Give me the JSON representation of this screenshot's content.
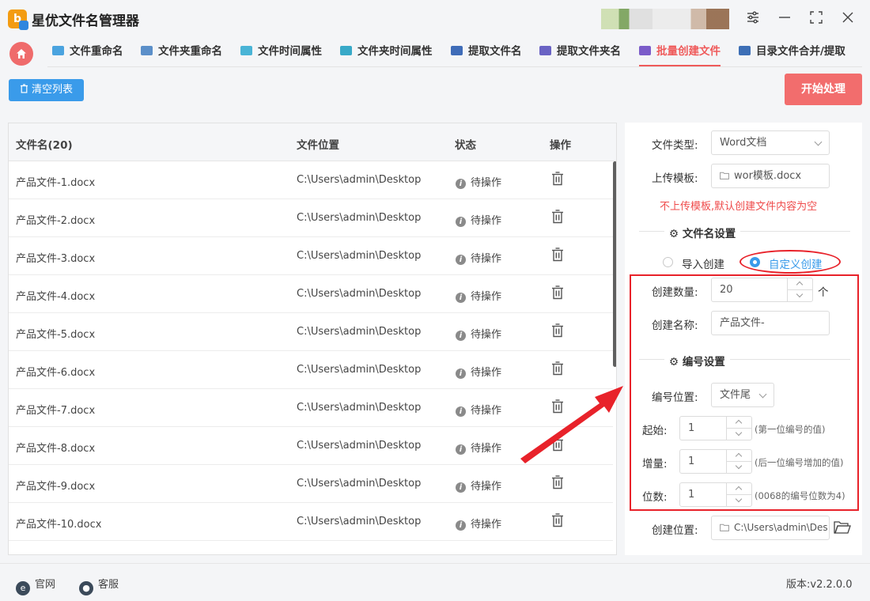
{
  "app": {
    "title": "星优文件名管理器"
  },
  "nav": {
    "tabs": [
      {
        "label": "文件重命名",
        "icon": "image-icon",
        "color": "#4aa3df"
      },
      {
        "label": "文件夹重命名",
        "icon": "folder-image-icon",
        "color": "#5b8fc9"
      },
      {
        "label": "文件时间属性",
        "icon": "layers-icon",
        "color": "#49b4d6"
      },
      {
        "label": "文件夹时间属性",
        "icon": "layers-icon",
        "color": "#38a9c8"
      },
      {
        "label": "提取文件名",
        "icon": "document-icon",
        "color": "#3f6cb8"
      },
      {
        "label": "提取文件夹名",
        "icon": "document-icon",
        "color": "#6a63c4"
      },
      {
        "label": "批量创建文件",
        "icon": "batch-create-icon",
        "color": "#7b5cc9",
        "active": true
      },
      {
        "label": "目录文件合并/提取",
        "icon": "book-icon",
        "color": "#3d6fb6"
      }
    ]
  },
  "toolbar": {
    "clear_label": "清空列表",
    "start_label": "开始处理"
  },
  "table": {
    "headers": [
      "文件名(20)",
      "文件位置",
      "状态",
      "操作"
    ],
    "rows": [
      {
        "name": "产品文件-1.docx",
        "path": "C:\\Users\\admin\\Desktop",
        "status": "待操作"
      },
      {
        "name": "产品文件-2.docx",
        "path": "C:\\Users\\admin\\Desktop",
        "status": "待操作"
      },
      {
        "name": "产品文件-3.docx",
        "path": "C:\\Users\\admin\\Desktop",
        "status": "待操作"
      },
      {
        "name": "产品文件-4.docx",
        "path": "C:\\Users\\admin\\Desktop",
        "status": "待操作"
      },
      {
        "name": "产品文件-5.docx",
        "path": "C:\\Users\\admin\\Desktop",
        "status": "待操作"
      },
      {
        "name": "产品文件-6.docx",
        "path": "C:\\Users\\admin\\Desktop",
        "status": "待操作"
      },
      {
        "name": "产品文件-7.docx",
        "path": "C:\\Users\\admin\\Desktop",
        "status": "待操作"
      },
      {
        "name": "产品文件-8.docx",
        "path": "C:\\Users\\admin\\Desktop",
        "status": "待操作"
      },
      {
        "name": "产品文件-9.docx",
        "path": "C:\\Users\\admin\\Desktop",
        "status": "待操作"
      },
      {
        "name": "产品文件-10.docx",
        "path": "C:\\Users\\admin\\Desktop",
        "status": "待操作"
      }
    ]
  },
  "settings": {
    "file_type_label": "文件类型:",
    "file_type_value": "Word文档",
    "template_label": "上传模板:",
    "template_value": "wor模板.docx",
    "warning": "不上传模板,默认创建文件内容为空",
    "filename_section": "文件名设置",
    "radio_import": "导入创建",
    "radio_custom": "自定义创建",
    "count_label": "创建数量:",
    "count_value": "20",
    "count_unit": "个",
    "name_label": "创建名称:",
    "name_value": "产品文件-",
    "numbering_section": "编号设置",
    "position_label": "编号位置:",
    "position_value": "文件尾",
    "start_label": "起始:",
    "start_value": "1",
    "start_hint": "(第一位编号的值)",
    "step_label": "增量:",
    "step_value": "1",
    "step_hint": "(后一位编号增加的值)",
    "digits_label": "位数:",
    "digits_value": "1",
    "digits_hint": "(0068的编号位数为4)",
    "location_label": "创建位置:",
    "location_value": "C:\\Users\\admin\\Des"
  },
  "status_bar": {
    "website": "官网",
    "support": "客服",
    "version": "版本:v2.2.0.0"
  },
  "colors": {
    "accent_red": "#ef5a5a",
    "primary_blue": "#3a9bea",
    "annotation_red": "#e8222a"
  }
}
